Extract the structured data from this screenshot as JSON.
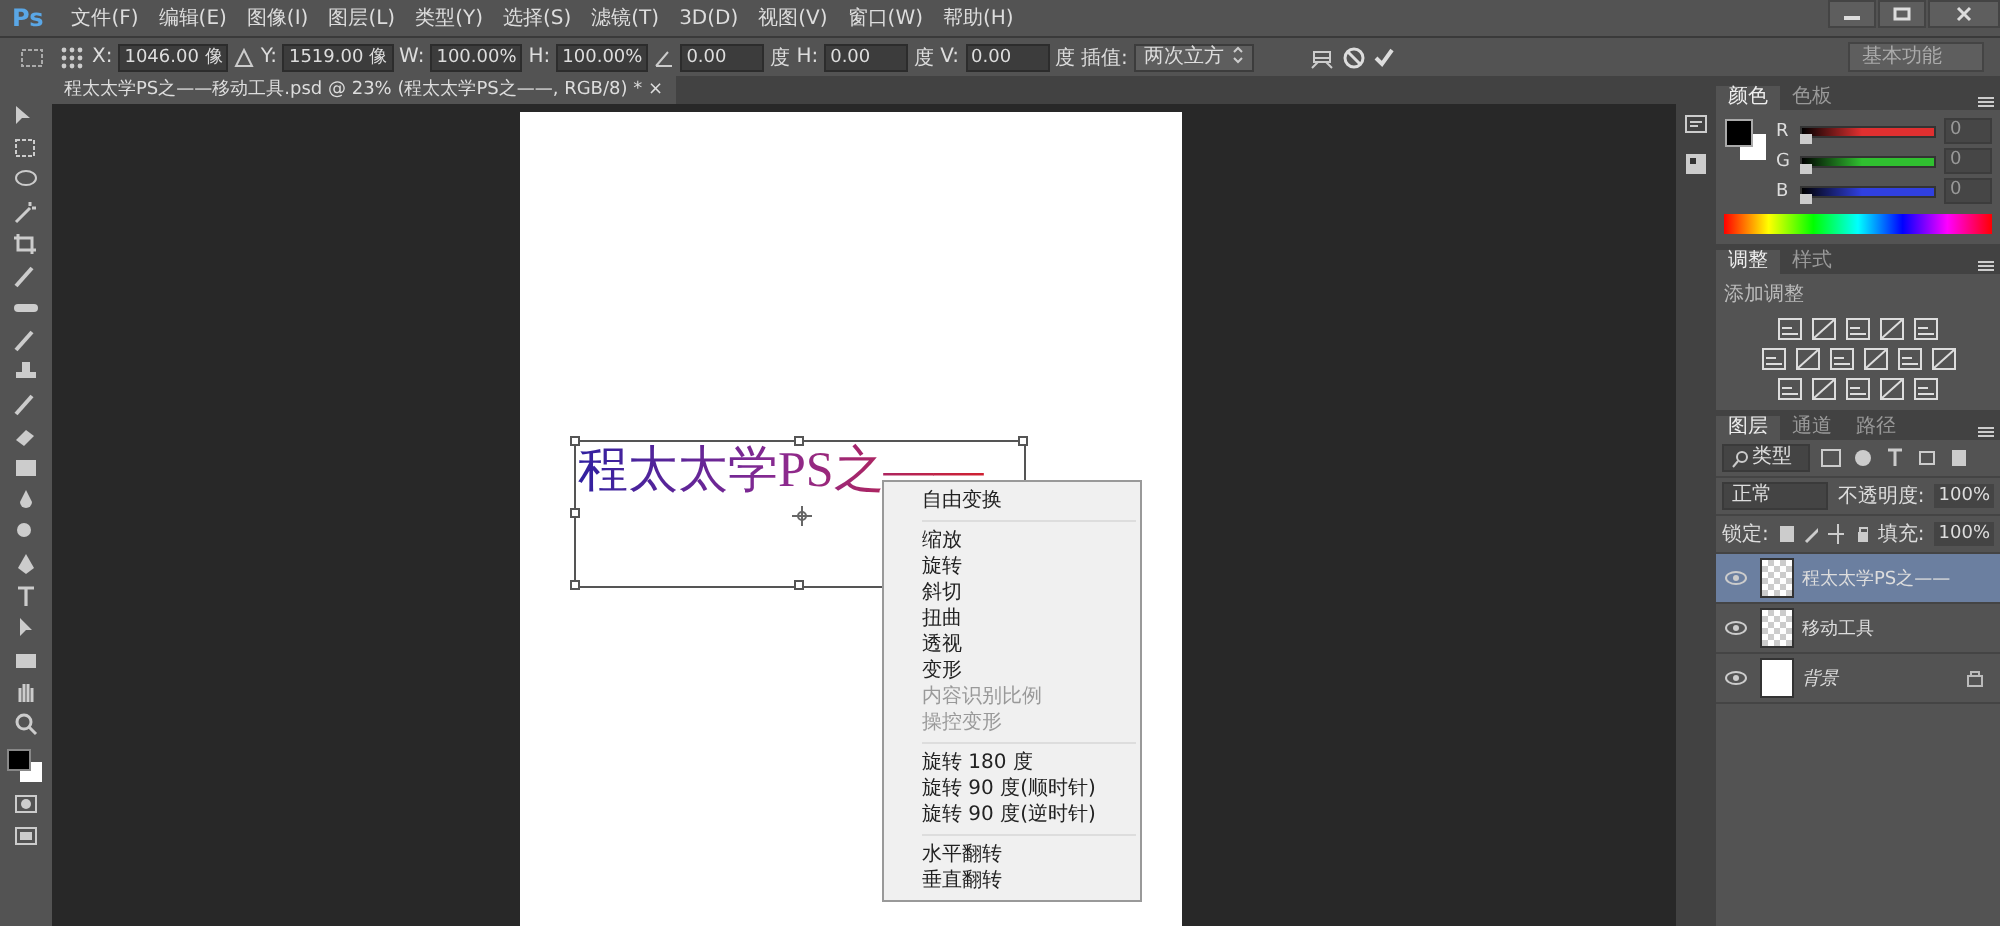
{
  "app": {
    "logo": "Ps"
  },
  "menu": [
    "文件(F)",
    "编辑(E)",
    "图像(I)",
    "图层(L)",
    "类型(Y)",
    "选择(S)",
    "滤镜(T)",
    "3D(D)",
    "视图(V)",
    "窗口(W)",
    "帮助(H)"
  ],
  "options_bar": {
    "fields": [
      {
        "kind": "labeled",
        "label": "X:",
        "value": "1046.00 像"
      },
      {
        "kind": "labeled",
        "label": "Y:",
        "value": "1519.00 像"
      },
      {
        "kind": "labeled",
        "label": "W:",
        "value": "100.00%"
      },
      {
        "kind": "labeled",
        "label": "H:",
        "value": "100.00%"
      },
      {
        "kind": "angle",
        "value": "0.00",
        "unit": "度"
      },
      {
        "kind": "labeled",
        "label": "H:",
        "value": "0.00",
        "unit": "度"
      },
      {
        "kind": "labeled",
        "label": "V:",
        "value": "0.00",
        "unit": "度"
      }
    ],
    "interpolation_label": "插值:",
    "interpolation": "两次立方",
    "workspace": "基本功能"
  },
  "document_tab": {
    "title": "程太太学PS之——移动工具.psd @ 23% (程太太学PS之——, RGB/8) *",
    "close": "×"
  },
  "canvas": {
    "text": "程太太学PS之——"
  },
  "context_menu": {
    "groups": [
      [
        {
          "label": "自由变换",
          "disabled": false
        }
      ],
      [
        {
          "label": "缩放",
          "disabled": false
        },
        {
          "label": "旋转",
          "disabled": false
        },
        {
          "label": "斜切",
          "disabled": false
        },
        {
          "label": "扭曲",
          "disabled": false
        },
        {
          "label": "透视",
          "disabled": false
        },
        {
          "label": "变形",
          "disabled": false
        },
        {
          "label": "内容识别比例",
          "disabled": true
        },
        {
          "label": "操控变形",
          "disabled": true
        }
      ],
      [
        {
          "label": "旋转 180 度",
          "disabled": false
        },
        {
          "label": "旋转 90 度(顺时针)",
          "disabled": false
        },
        {
          "label": "旋转 90 度(逆时针)",
          "disabled": false
        }
      ],
      [
        {
          "label": "水平翻转",
          "disabled": false
        },
        {
          "label": "垂直翻转",
          "disabled": false
        }
      ]
    ]
  },
  "color_panel": {
    "tabs": [
      {
        "label": "颜色",
        "selected": true
      },
      {
        "label": "色板",
        "selected": false
      }
    ],
    "channels": [
      {
        "name": "R",
        "value": "0",
        "level": 0,
        "color": "#e03030"
      },
      {
        "name": "G",
        "value": "0",
        "level": 0,
        "color": "#30c030"
      },
      {
        "name": "B",
        "value": "0",
        "level": 0,
        "color": "#3040e0"
      }
    ]
  },
  "adjustments_panel": {
    "tabs": [
      {
        "label": "调整",
        "selected": true
      },
      {
        "label": "样式",
        "selected": false
      }
    ],
    "title": "添加调整"
  },
  "layers_panel": {
    "tabs": [
      {
        "label": "图层",
        "selected": true
      },
      {
        "label": "通道",
        "selected": false
      },
      {
        "label": "路径",
        "selected": false
      }
    ],
    "filter": "类型",
    "blend_mode": "正常",
    "opacity_label": "不透明度:",
    "opacity": "100%",
    "lock_label": "锁定:",
    "fill_label": "填充:",
    "fill": "100%",
    "layers": [
      {
        "name": "程太太学PS之——",
        "kind": "text",
        "selected": true,
        "visible": true,
        "locked": false
      },
      {
        "name": "移动工具",
        "kind": "text",
        "selected": false,
        "visible": true,
        "locked": false
      },
      {
        "name": "背景",
        "kind": "background",
        "selected": false,
        "visible": true,
        "locked": true
      }
    ]
  }
}
